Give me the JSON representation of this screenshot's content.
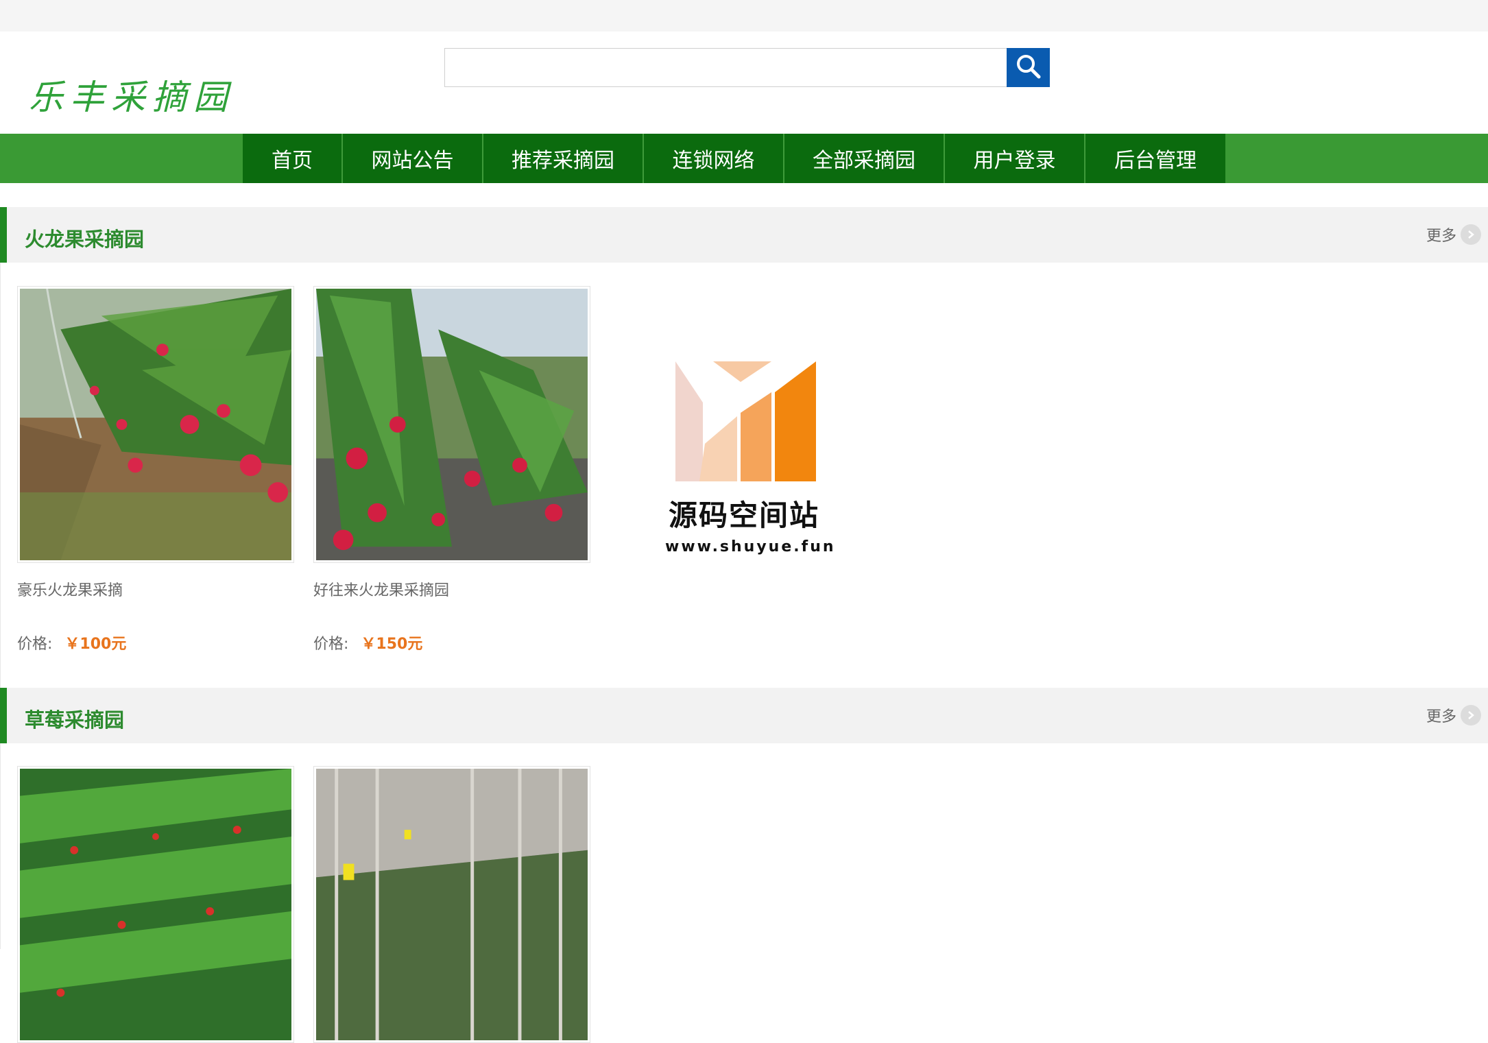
{
  "header": {
    "logo_text": "乐丰采摘园",
    "search": {
      "value": "",
      "placeholder": ""
    }
  },
  "nav": {
    "items": [
      {
        "label": "首页"
      },
      {
        "label": "网站公告"
      },
      {
        "label": "推荐采摘园"
      },
      {
        "label": "连锁网络"
      },
      {
        "label": "全部采摘园"
      },
      {
        "label": "用户登录"
      },
      {
        "label": "后台管理"
      }
    ]
  },
  "sections": [
    {
      "title": "火龙果采摘园",
      "more": "更多",
      "items": [
        {
          "name": "豪乐火龙果采摘",
          "price_label": "价格:",
          "price": "￥100元"
        },
        {
          "name": "好往来火龙果采摘园",
          "price_label": "价格:",
          "price": "￥150元"
        }
      ]
    },
    {
      "title": "草莓采摘园",
      "more": "更多",
      "items": [
        {
          "name": "",
          "price_label": "",
          "price": ""
        },
        {
          "name": "",
          "price_label": "",
          "price": ""
        }
      ]
    }
  ],
  "watermark": {
    "title": "源码空间站",
    "url": "www.shuyue.fun"
  },
  "colors": {
    "nav_bg": "#3a9a34",
    "nav_active": "#0b6b0e",
    "price": "#e8741d",
    "search_btn": "#0a5bb0"
  }
}
